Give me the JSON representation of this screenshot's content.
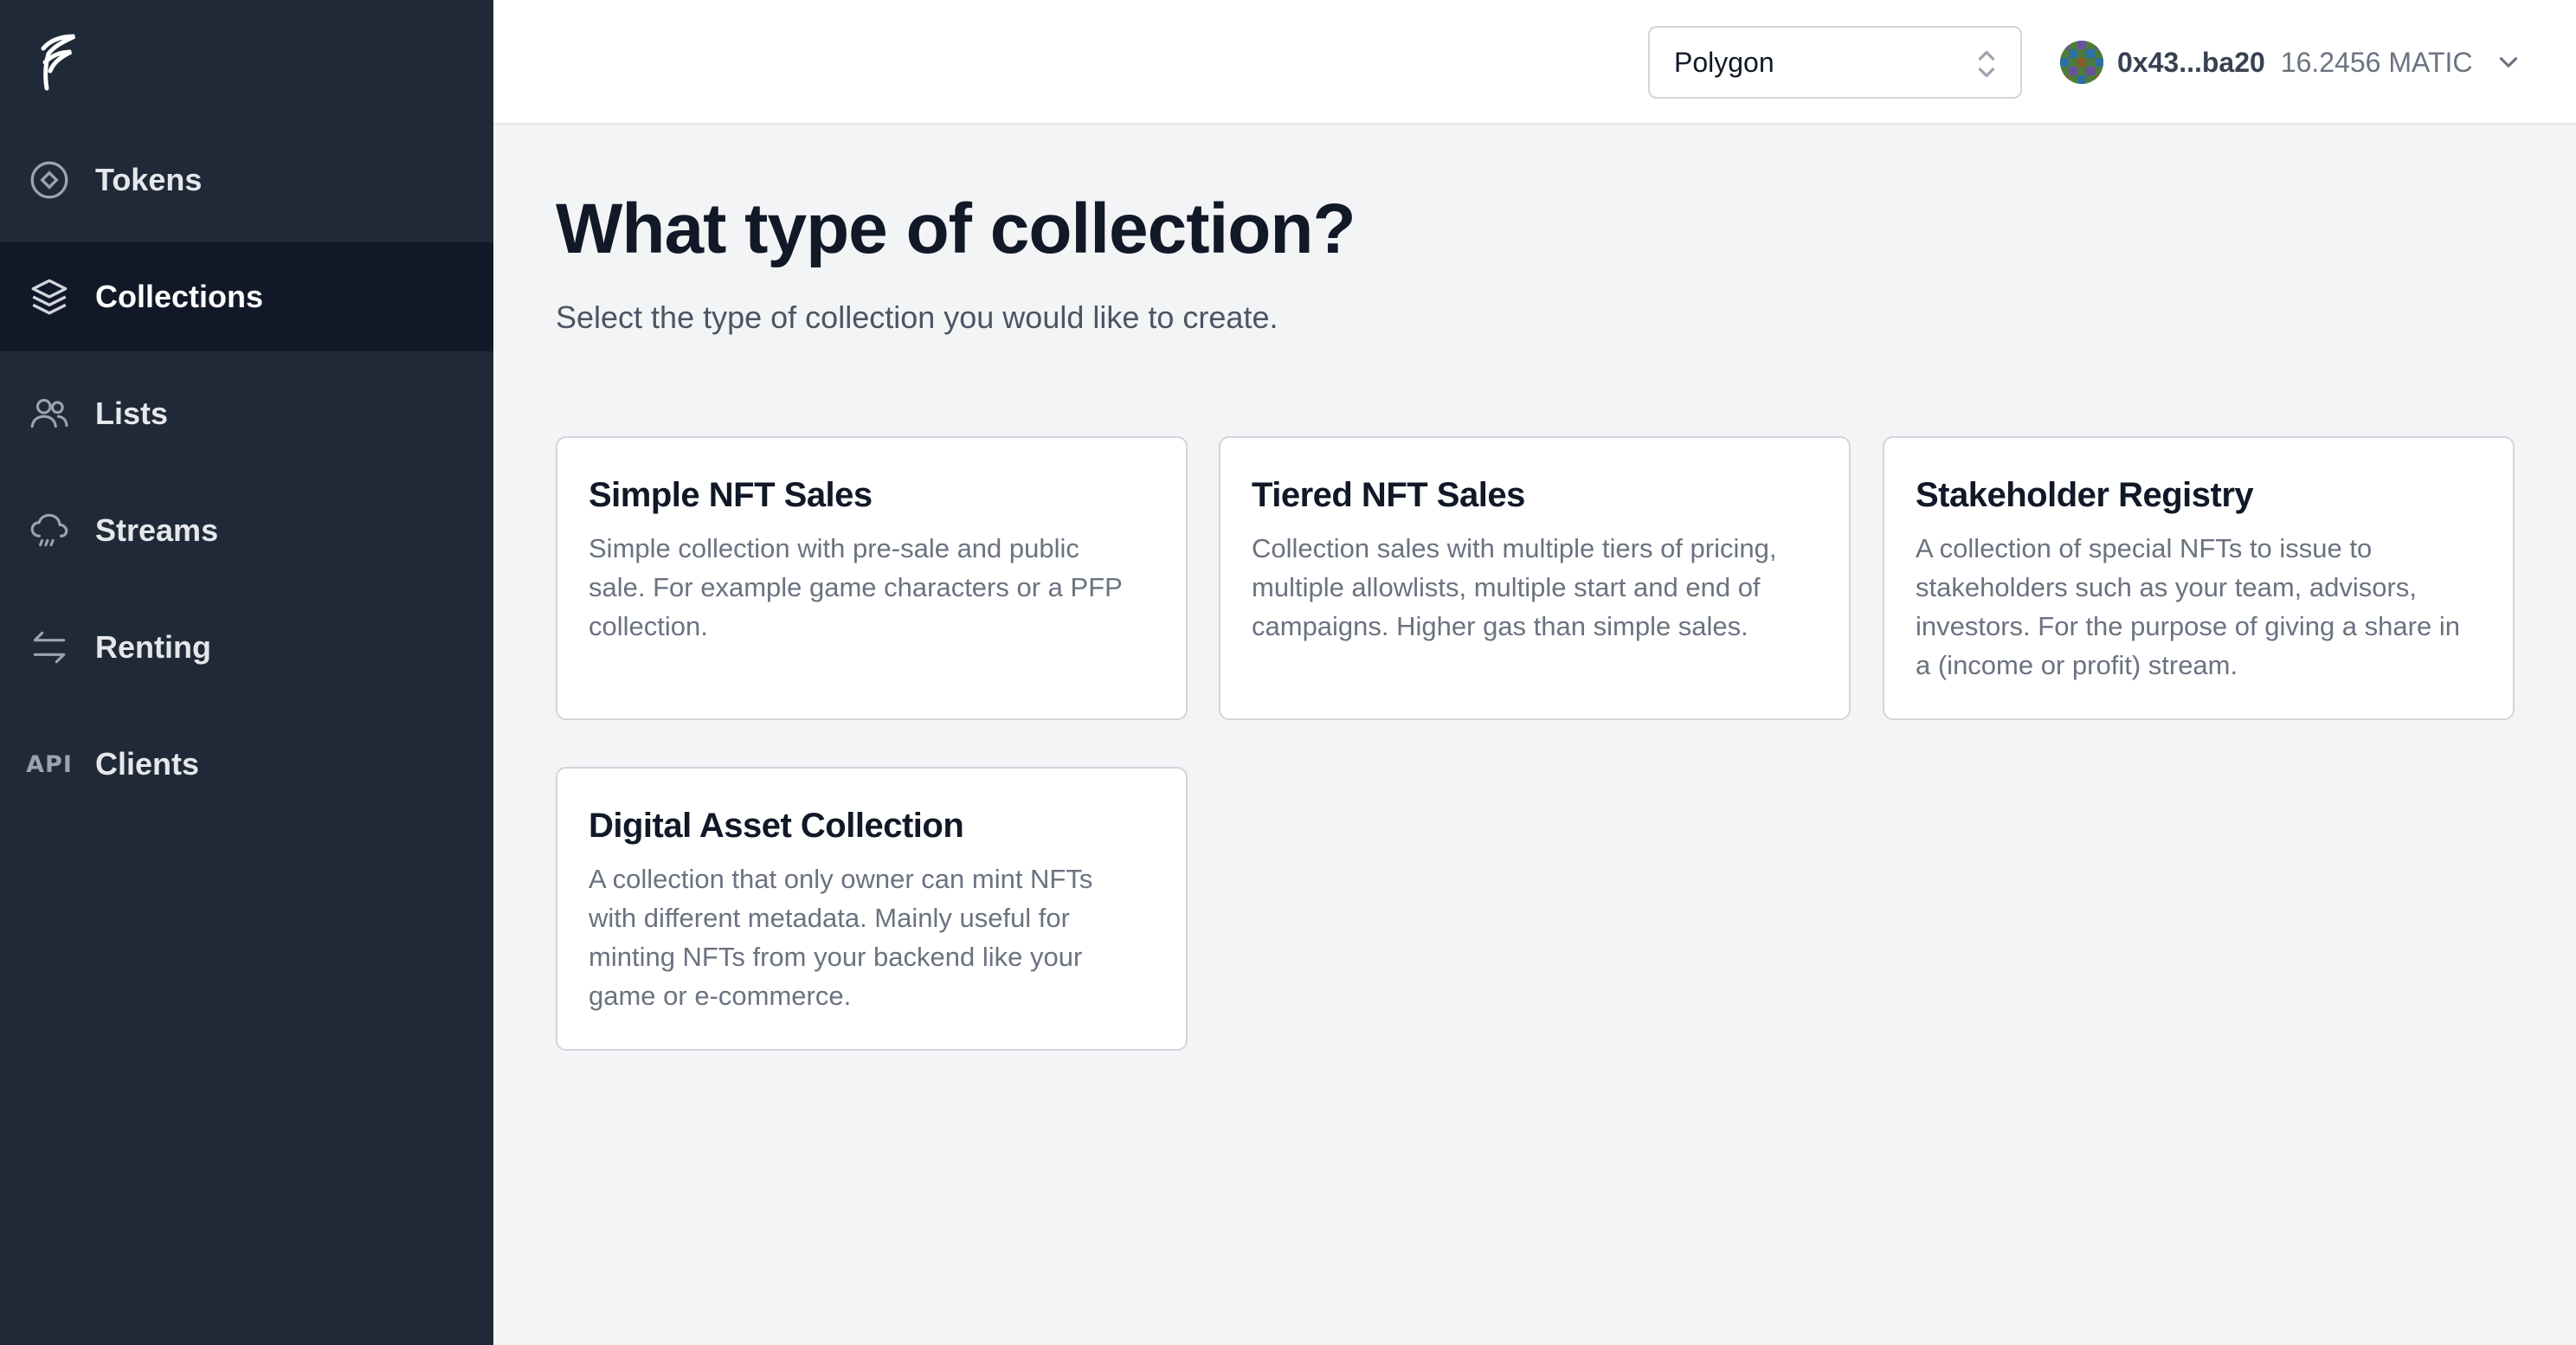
{
  "sidebar": {
    "items": [
      {
        "label": "Tokens",
        "icon": "diamond-circle-icon"
      },
      {
        "label": "Collections",
        "icon": "stack-icon",
        "active": true
      },
      {
        "label": "Lists",
        "icon": "users-icon"
      },
      {
        "label": "Streams",
        "icon": "cloud-rain-icon"
      },
      {
        "label": "Renting",
        "icon": "arrows-exchange-icon"
      },
      {
        "label": "Clients",
        "icon": "api-icon",
        "icon_text": "API"
      }
    ]
  },
  "header": {
    "network": {
      "selected": "Polygon"
    },
    "wallet": {
      "address": "0x43...ba20",
      "balance": "16.2456 MATIC"
    }
  },
  "main": {
    "title": "What type of collection?",
    "subtitle": "Select the type of collection you would like to create.",
    "cards": [
      {
        "title": "Simple NFT Sales",
        "description": "Simple collection with pre-sale and public sale. For example game characters or a PFP collection."
      },
      {
        "title": "Tiered NFT Sales",
        "description": "Collection sales with multiple tiers of pricing, multiple allowlists, multiple start and end of campaigns. Higher gas than simple sales."
      },
      {
        "title": "Stakeholder Registry",
        "description": "A collection of special NFTs to issue to stakeholders such as your team, advisors, investors. For the purpose of giving a share in a (income or profit) stream."
      },
      {
        "title": "Digital Asset Collection",
        "description": "A collection that only owner can mint NFTs with different metadata. Mainly useful for minting NFTs from your backend like your game or e-commerce."
      }
    ]
  },
  "colors": {
    "sidebar_bg": "#1f2937",
    "sidebar_active_bg": "#111827",
    "main_bg": "#f3f4f6",
    "card_border": "#d1d5db"
  }
}
